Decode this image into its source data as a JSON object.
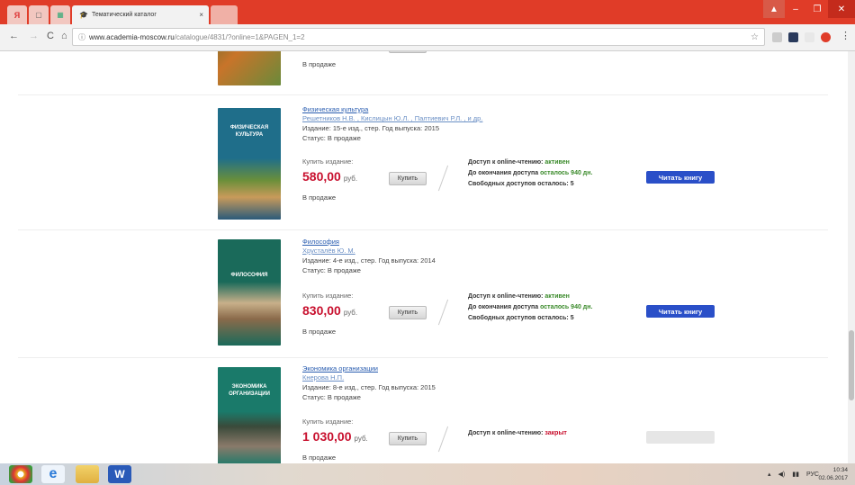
{
  "browser": {
    "active_tab_title": "Тематический каталог",
    "tab_close": "×",
    "url_host": "www.academia-moscow.ru",
    "url_path": "/catalogue/4831/?online=1&PAGEN_1=2"
  },
  "colors": {
    "accent_blue": "#2a4fc8",
    "price_red": "#c8102e",
    "status_green": "#3a8a2a"
  },
  "top_partial": {
    "sale_label": "В продаже"
  },
  "books": [
    {
      "title": "Физическая культура",
      "authors": "Решетников Н.В. , Кислицын Ю.Л. , Палтиевич Р.Л. , и др.",
      "edition": "Издание: 15-е изд., стер. Год выпуска: 2015",
      "status": "Статус: В продаже",
      "buy_label": "Купить издание:",
      "price": "580,00",
      "currency": "руб.",
      "buy_button": "Купить",
      "sale_label": "В продаже",
      "access_label": "Доступ к online-чтению:",
      "access_value": "активен",
      "expiry_label": "До окончания доступа",
      "expiry_value": "осталось 940 дн.",
      "free_access": "Свободных доступов осталось: 5",
      "read_button": "Читать книгу",
      "cover_text": "ФИЗИЧЕСКАЯ КУЛЬТУРА"
    },
    {
      "title": "Философия",
      "authors": "Хрусталёв Ю. М.",
      "edition": "Издание: 4-е изд., стер. Год выпуска: 2014",
      "status": "Статус: В продаже",
      "buy_label": "Купить издание:",
      "price": "830,00",
      "currency": "руб.",
      "buy_button": "Купить",
      "sale_label": "В продаже",
      "access_label": "Доступ к online-чтению:",
      "access_value": "активен",
      "expiry_label": "До окончания доступа",
      "expiry_value": "осталось 940 дн.",
      "free_access": "Свободных доступов осталось: 5",
      "read_button": "Читать книгу",
      "cover_text": "ФИЛОСОФИЯ"
    },
    {
      "title": "Экономика организации",
      "authors": "Кнерова Н.П.",
      "edition": "Издание: 8-е изд., стер. Год выпуска: 2015",
      "status": "Статус: В продаже",
      "buy_label": "Купить издание:",
      "price": "1 030,00",
      "currency": "руб.",
      "buy_button": "Купить",
      "sale_label": "В продаже",
      "access_label": "Доступ к online-чтению:",
      "access_value": "закрыт",
      "cover_text": "ЭКОНОМИКА ОРГАНИЗАЦИИ"
    }
  ],
  "taskbar": {
    "lang": "РУС",
    "time": "10:34",
    "date": "02.06.2017"
  }
}
